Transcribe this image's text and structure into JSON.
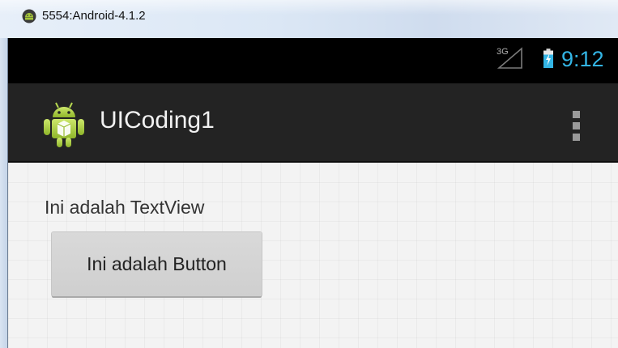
{
  "window": {
    "title": "5554:Android-4.1.2",
    "icon": "android-emulator-icon"
  },
  "status_bar": {
    "network": "3G",
    "time": "9:12",
    "icons": [
      "signal-3g-icon",
      "battery-charging-icon"
    ],
    "accent_color": "#33b5e5"
  },
  "action_bar": {
    "title": "UICoding1",
    "app_icon": "android-app-icon",
    "overflow_icon": "overflow-menu-icon"
  },
  "content": {
    "text_view": "Ini adalah TextView",
    "button_label": "Ini adalah Button"
  }
}
